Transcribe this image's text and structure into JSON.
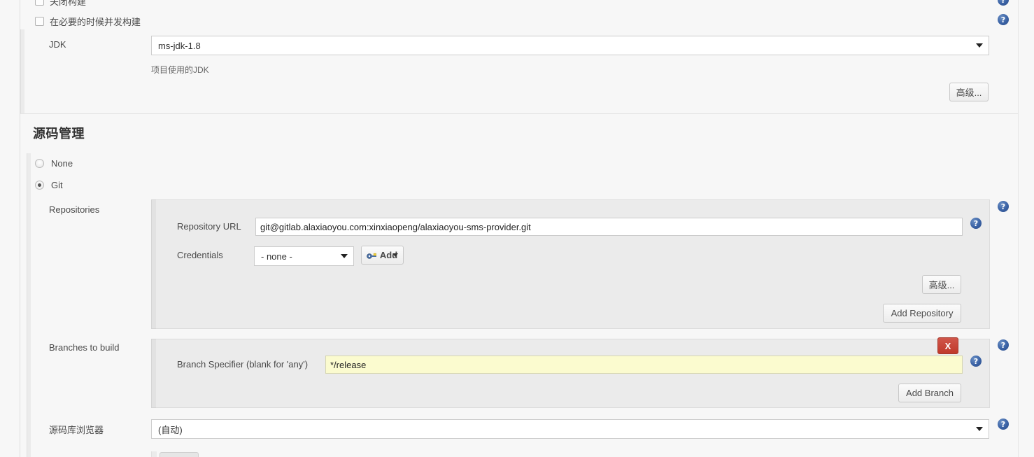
{
  "general": {
    "cutoff_checkbox_label": "关闭构建",
    "concurrent_build_label": "在必要的时候并发构建",
    "jdk_label": "JDK",
    "jdk_value": "ms-jdk-1.8",
    "jdk_help_note": "项目使用的JDK",
    "advanced_button": "高级..."
  },
  "scm": {
    "section_title": "源码管理",
    "radio_none_label": "None",
    "radio_git_label": "Git",
    "repositories_label": "Repositories",
    "repository_url_label": "Repository URL",
    "repository_url_value": "git@gitlab.alaxiaoyou.com:xinxiaopeng/alaxiaoyou-sms-provider.git",
    "credentials_label": "Credentials",
    "credentials_value": "- none -",
    "credentials_add_button": "Add",
    "repo_advanced_button": "高级...",
    "add_repository_button": "Add Repository",
    "branches_label": "Branches to build",
    "branch_specifier_label": "Branch Specifier (blank for 'any')",
    "branch_specifier_value": "*/release",
    "branch_delete_button": "X",
    "add_branch_button": "Add Branch",
    "repo_browser_label": "源码库浏览器",
    "repo_browser_value": "(自动)"
  },
  "icons": {
    "help": "?",
    "key": "key-icon"
  },
  "colors": {
    "help_blue": "#3a62a5",
    "danger_red": "#c0392b",
    "highlight_yellow": "#fbfbcf",
    "panel_gray": "#ebebeb"
  }
}
